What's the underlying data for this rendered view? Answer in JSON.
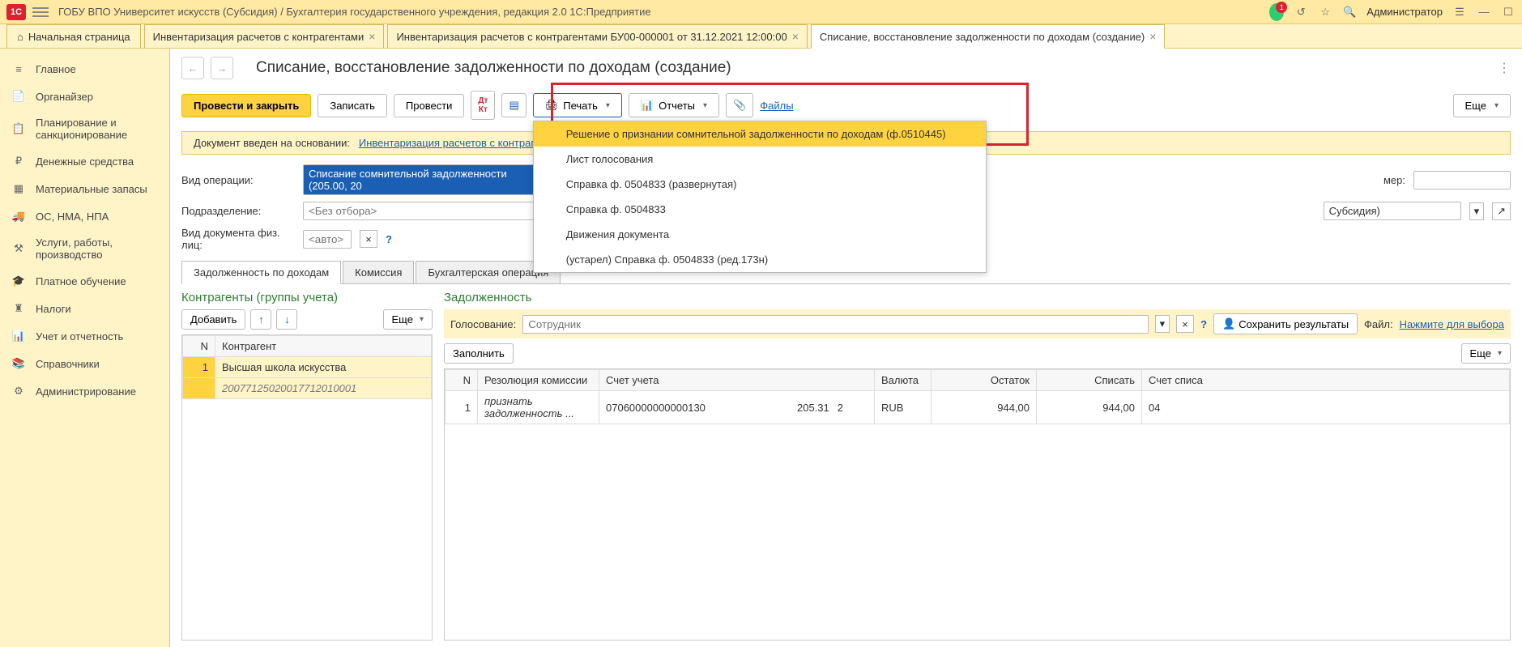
{
  "header": {
    "title": "ГОБУ ВПО Университет искусств (Субсидия) / Бухгалтерия государственного учреждения, редакция 2.0 1С:Предприятие",
    "user": "Администратор"
  },
  "tabs": {
    "home": "Начальная страница",
    "t1": "Инвентаризация расчетов с контрагентами",
    "t2": "Инвентаризация расчетов с контрагентами БУ00-000001 от 31.12.2021 12:00:00",
    "t3": "Списание, восстановление задолженности по доходам (создание)"
  },
  "sidebar": {
    "items": [
      "Главное",
      "Органайзер",
      "Планирование и санкционирование",
      "Денежные средства",
      "Материальные запасы",
      "ОС, НМА, НПА",
      "Услуги, работы, производство",
      "Платное обучение",
      "Налоги",
      "Учет и отчетность",
      "Справочники",
      "Администрирование"
    ]
  },
  "page": {
    "title": "Списание, восстановление задолженности по доходам (создание)"
  },
  "toolbar": {
    "postClose": "Провести и закрыть",
    "write": "Записать",
    "post": "Провести",
    "print": "Печать",
    "reports": "Отчеты",
    "files": "Файлы",
    "more": "Еще"
  },
  "printMenu": {
    "i1": "Решение о признании сомнительной задолженности по доходам (ф.0510445)",
    "i2": "Лист голосования",
    "i3": "Справка ф. 0504833 (развернутая)",
    "i4": "Справка ф. 0504833",
    "i5": "Движения документа",
    "i6": "(устарел) Справка ф. 0504833 (ред.173н)"
  },
  "note": {
    "label": "Документ введен на основании:",
    "link": "Инвентаризация расчетов с контрагентами"
  },
  "form": {
    "opTypeLabel": "Вид операции:",
    "opTypeValue": "Списание сомнительной задолженности (205.00, 20",
    "deptLabel": "Подразделение:",
    "deptPlaceholder": "<Без отбора>",
    "docTypeLabel": "Вид документа физ. лиц:",
    "docTypePlaceholder": "<авто>",
    "numberLabel": "мер:",
    "orgValue": "Субсидия)"
  },
  "innerTabs": {
    "t1": "Задолженность по доходам",
    "t2": "Комиссия",
    "t3": "Бухгалтерская операция"
  },
  "leftPanel": {
    "title": "Контрагенты (группы учета)",
    "add": "Добавить",
    "more": "Еще",
    "colN": "N",
    "colName": "Контрагент",
    "row1num": "1",
    "row1name": "Высшая школа искусства",
    "row1sub": "20077125020017712010001"
  },
  "rightPanel": {
    "title": "Задолженность",
    "voteLabel": "Голосование:",
    "votePlaceholder": "Сотрудник",
    "save": "Сохранить результаты",
    "fileLabel": "Файл:",
    "fileLink": "Нажмите для выбора",
    "fill": "Заполнить",
    "more": "Еще",
    "cols": {
      "n": "N",
      "res": "Резолюция комиссии",
      "acc": "Счет учета",
      "cur": "Валюта",
      "bal": "Остаток",
      "wr": "Списать",
      "accWr": "Счет списа"
    },
    "row1": {
      "n": "1",
      "res": "признать задолженность ...",
      "acc1": "07060000000000130",
      "acc2": "2",
      "acc3": "205.31",
      "cur": "RUB",
      "bal": "944,00",
      "wr": "944,00",
      "accWr": "04"
    }
  }
}
